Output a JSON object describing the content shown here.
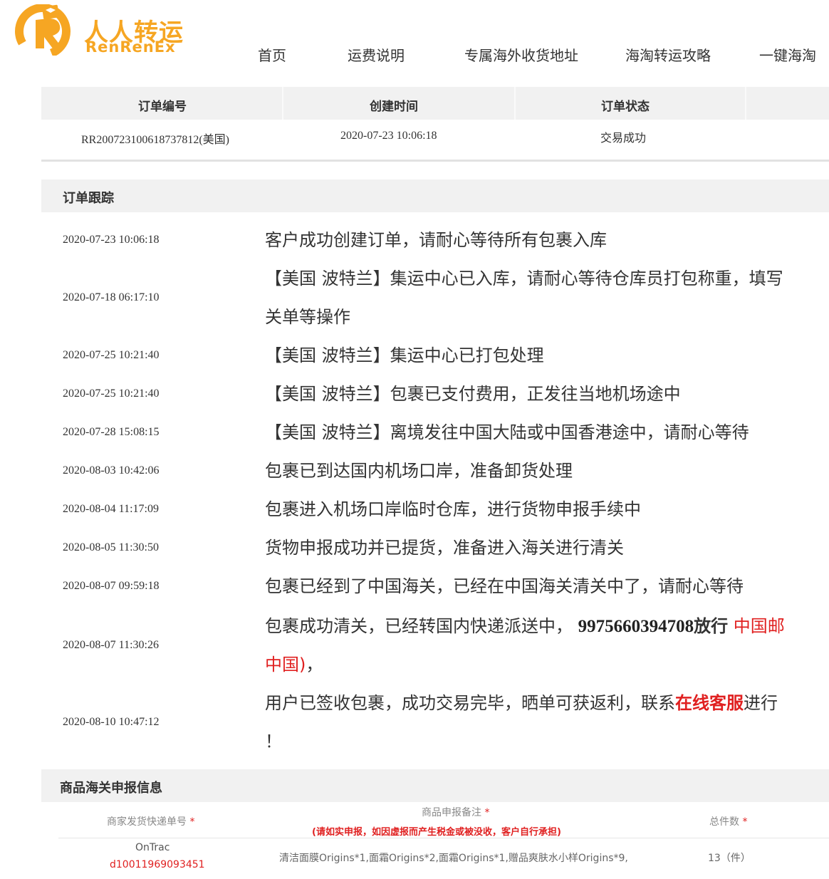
{
  "brand": {
    "name_cn": "人人转运",
    "name_en": "RenRenEx",
    "accent": "#f6a623"
  },
  "nav": {
    "items": [
      "首页",
      "运费说明",
      "专属海外收货地址",
      "海淘转运攻略",
      "一键海淘"
    ]
  },
  "order": {
    "headers": [
      "订单编号",
      "创建时间",
      "订单状态"
    ],
    "number": "RR200723100618737812",
    "country": "(美国)",
    "created": "2020-07-23 10:06:18",
    "status": "交易成功"
  },
  "tracking": {
    "title": "订单跟踪",
    "events": [
      {
        "time": "2020-07-23 10:06:18",
        "lines": [
          "客户成功创建订单，请耐心等待所有包裹入库"
        ]
      },
      {
        "time": "2020-07-18 06:17:10",
        "lines": [
          "【美国 波特兰】集运中心已入库，请耐心等待仓库员打包称重，填写",
          "关单等操作"
        ]
      },
      {
        "time": "2020-07-25 10:21:40",
        "lines": [
          "【美国 波特兰】集运中心已打包处理"
        ]
      },
      {
        "time": "2020-07-25 10:21:40",
        "lines": [
          "【美国 波特兰】包裹已支付费用，正发往当地机场途中"
        ]
      },
      {
        "time": "2020-07-28 15:08:15",
        "lines": [
          "【美国 波特兰】离境发往中国大陆或中国香港途中，请耐心等待"
        ]
      },
      {
        "time": "2020-08-03 10:42:06",
        "lines": [
          "包裹已到达国内机场口岸，准备卸货处理"
        ]
      },
      {
        "time": "2020-08-04 11:17:09",
        "lines": [
          "包裹进入机场口岸临时仓库，进行货物申报手续中"
        ]
      },
      {
        "time": "2020-08-05 11:30:50",
        "lines": [
          "货物申报成功并已提货，准备进入海关进行清关"
        ]
      },
      {
        "time": "2020-08-07 09:59:18",
        "lines": [
          "包裹已经到了中国海关，已经在中国海关清关中了，请耐心等待"
        ]
      },
      {
        "time": "2020-08-07 11:30:26",
        "prefix": "包裹成功清关，已经转国内快递派送中，",
        "tracking_no": "9975660394708",
        "release": "放行",
        "carrier": "中国邮",
        "carrier_cont": "中国)",
        "suffix": "，"
      },
      {
        "time": "2020-08-10 10:47:12",
        "prefix": "用户已签收包裹，成功交易完毕，晒单可获返利，联系",
        "link": "在线客服",
        "suffix": "进行",
        "line2": "！"
      }
    ]
  },
  "customs": {
    "title": "商品海关申报信息",
    "col_tracking": "商家发货快递单号",
    "col_note": "商品申报备注",
    "col_note_warning": "(请如实申报，如因虚报而产生税金或被没收，客户自行承担)",
    "col_count": "总件数",
    "required_mark": "*",
    "rows": [
      {
        "carrier": "OnTrac",
        "tracking": "d10011969093451",
        "note": "清洁面膜Origins*1,面霜Origins*2,面霜Origins*1,赠品爽肤水小样Origins*9,",
        "count": "13（件）"
      }
    ]
  }
}
